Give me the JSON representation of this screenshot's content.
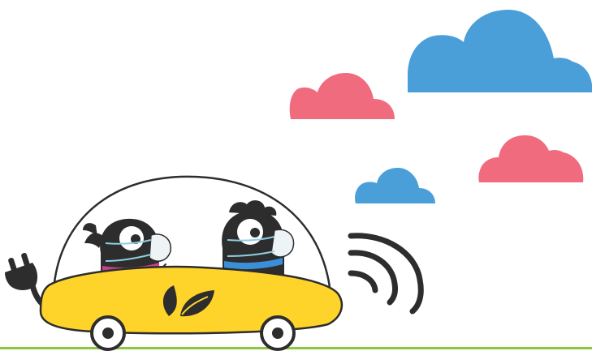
{
  "colors": {
    "background": "#ffffff",
    "cloud_blue": "#4a9fd8",
    "cloud_pink": "#f06b7e",
    "car_body": "#ffd42a",
    "outline": "#2d2d2d",
    "dome_fill": "#ffffff",
    "ground": "#8dc63f",
    "scarf_left": "#c8408a",
    "scarf_right": "#3a8fd8",
    "mask": "#eef3f6",
    "mask_strap": "#8fcfe0"
  },
  "icons": {
    "plug": "electric-plug-icon",
    "leaf": "leaf-icon",
    "signal": "wireless-signal-icon"
  }
}
